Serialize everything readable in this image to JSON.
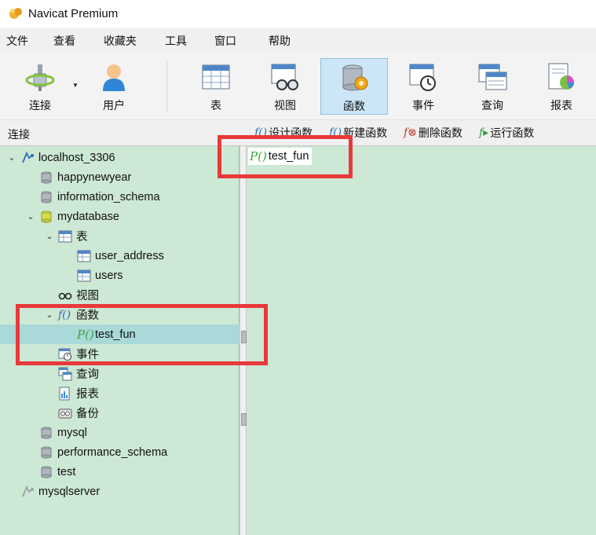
{
  "window": {
    "title": "Navicat Premium"
  },
  "menu": [
    "文件",
    "查看",
    "收藏夹",
    "工具",
    "窗口",
    "帮助"
  ],
  "toolbar": {
    "buttons": [
      {
        "label": "连接",
        "icon": "connection-plug-icon"
      },
      {
        "label": "用户",
        "icon": "user-icon"
      },
      {
        "label": "表",
        "icon": "table-icon"
      },
      {
        "label": "视图",
        "icon": "view-icon"
      },
      {
        "label": "函数",
        "icon": "function-database-icon",
        "active": true
      },
      {
        "label": "事件",
        "icon": "event-clock-icon"
      },
      {
        "label": "查询",
        "icon": "query-icon"
      },
      {
        "label": "报表",
        "icon": "report-chart-icon"
      }
    ]
  },
  "subbar": {
    "left_label": "连接",
    "actions": [
      "设计函数",
      "新建函数",
      "删除函数",
      "运行函数"
    ]
  },
  "tree": [
    {
      "label": "localhost_3306",
      "icon": "connection-icon",
      "expanded": true
    },
    {
      "label": "happynewyear",
      "icon": "database-icon"
    },
    {
      "label": "information_schema",
      "icon": "database-icon"
    },
    {
      "label": "mydatabase",
      "icon": "database-open-icon",
      "expanded": true
    },
    {
      "label": "表",
      "icon": "table-folder-icon",
      "expanded": true
    },
    {
      "label": "user_address",
      "icon": "table-icon"
    },
    {
      "label": "users",
      "icon": "table-icon"
    },
    {
      "label": "视图",
      "icon": "view-glasses-icon"
    },
    {
      "label": "函数",
      "icon": "function-icon",
      "expanded": true
    },
    {
      "label": "test_fun",
      "icon": "procedure-icon",
      "selected": true
    },
    {
      "label": "事件",
      "icon": "event-icon"
    },
    {
      "label": "查询",
      "icon": "query-icon"
    },
    {
      "label": "报表",
      "icon": "report-icon"
    },
    {
      "label": "备份",
      "icon": "backup-icon"
    },
    {
      "label": "mysql",
      "icon": "database-icon"
    },
    {
      "label": "performance_schema",
      "icon": "database-icon"
    },
    {
      "label": "test",
      "icon": "database-icon"
    },
    {
      "label": "mysqlserver",
      "icon": "connection-disconnected-icon"
    }
  ],
  "content": {
    "items": [
      {
        "label": "test_fun",
        "icon": "procedure-icon"
      }
    ]
  },
  "colors": {
    "tree_bg": "#cde8d4",
    "selection": "#a9d9d9",
    "active_tool": "#cde6f7",
    "annotation_red": "#e8393a"
  }
}
